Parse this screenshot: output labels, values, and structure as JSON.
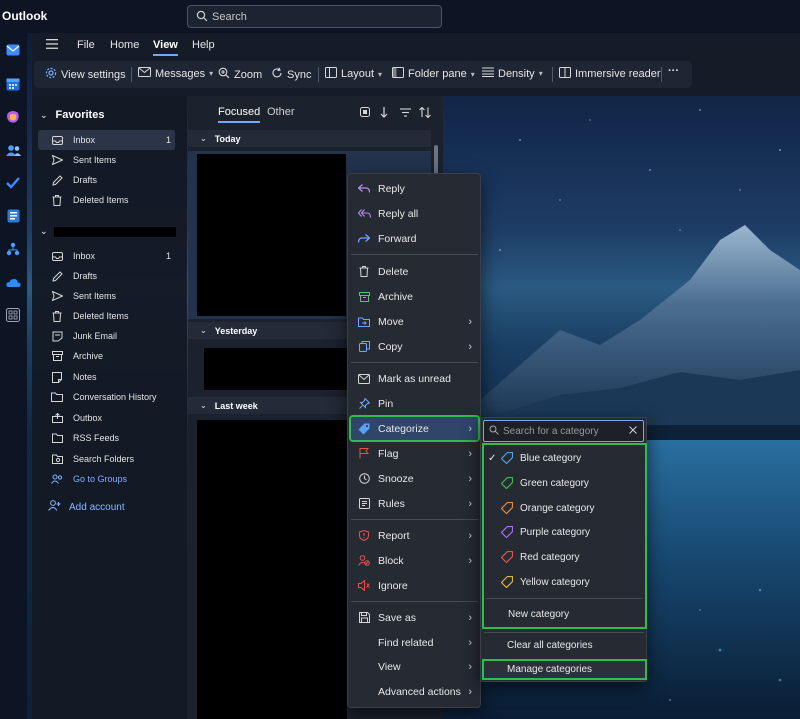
{
  "app": {
    "title": "Outlook"
  },
  "search": {
    "placeholder": "Search"
  },
  "ribbon": {
    "menu_tabs": [
      "File",
      "Home",
      "View",
      "Help"
    ],
    "active_tab": "View",
    "tools": {
      "view_settings": "View settings",
      "messages": "Messages",
      "zoom": "Zoom",
      "sync": "Sync",
      "layout": "Layout",
      "folder_pane": "Folder pane",
      "density": "Density",
      "immersive_reader": "Immersive reader",
      "more": "···"
    }
  },
  "folders": {
    "favorites_header": "Favorites",
    "favorites": [
      {
        "label": "Inbox",
        "count": "1",
        "icon": "inbox-icon",
        "selected": true
      },
      {
        "label": "Sent Items",
        "icon": "send-icon"
      },
      {
        "label": "Drafts",
        "icon": "drafts-icon"
      },
      {
        "label": "Deleted Items",
        "icon": "trash-icon"
      }
    ],
    "account": [
      {
        "label": "Inbox",
        "count": "1",
        "icon": "inbox-icon"
      },
      {
        "label": "Drafts",
        "icon": "drafts-icon"
      },
      {
        "label": "Sent Items",
        "icon": "send-icon"
      },
      {
        "label": "Deleted Items",
        "icon": "trash-icon"
      },
      {
        "label": "Junk Email",
        "icon": "junk-icon"
      },
      {
        "label": "Archive",
        "icon": "archive-icon"
      },
      {
        "label": "Notes",
        "icon": "notes-icon"
      },
      {
        "label": "Conversation History",
        "icon": "folder-icon"
      },
      {
        "label": "Outbox",
        "icon": "outbox-icon"
      },
      {
        "label": "RSS Feeds",
        "icon": "rss-icon"
      },
      {
        "label": "Search Folders",
        "icon": "search-folder-icon"
      },
      {
        "label": "Go to Groups",
        "icon": "groups-icon",
        "link": true
      }
    ],
    "add_account": "Add account"
  },
  "message_list": {
    "tabs": {
      "focused": "Focused",
      "other": "Other"
    },
    "groups": {
      "today": "Today",
      "yesterday": "Yesterday",
      "last_week": "Last week"
    }
  },
  "context_menu": {
    "reply": "Reply",
    "reply_all": "Reply all",
    "forward": "Forward",
    "delete": "Delete",
    "archive": "Archive",
    "move": "Move",
    "copy": "Copy",
    "mark_unread": "Mark as unread",
    "pin": "Pin",
    "categorize": "Categorize",
    "flag": "Flag",
    "snooze": "Snooze",
    "rules": "Rules",
    "report": "Report",
    "block": "Block",
    "ignore": "Ignore",
    "save_as": "Save as",
    "find_related": "Find related",
    "view": "View",
    "advanced_actions": "Advanced actions"
  },
  "categorize_menu": {
    "search_placeholder": "Search for a category",
    "categories": [
      {
        "label": "Blue category",
        "color": "#4aa3df",
        "checked": true
      },
      {
        "label": "Green category",
        "color": "#3fb950"
      },
      {
        "label": "Orange category",
        "color": "#e8873a"
      },
      {
        "label": "Purple category",
        "color": "#a371f7"
      },
      {
        "label": "Red category",
        "color": "#e5534b"
      },
      {
        "label": "Yellow category",
        "color": "#e3b341"
      }
    ],
    "new_category": "New category",
    "clear_all": "Clear all categories",
    "manage": "Manage categories",
    "checkmark": "✓"
  },
  "colors": {
    "highlight_outline": "#2ebd4e",
    "accent": "#6ea8ff"
  }
}
